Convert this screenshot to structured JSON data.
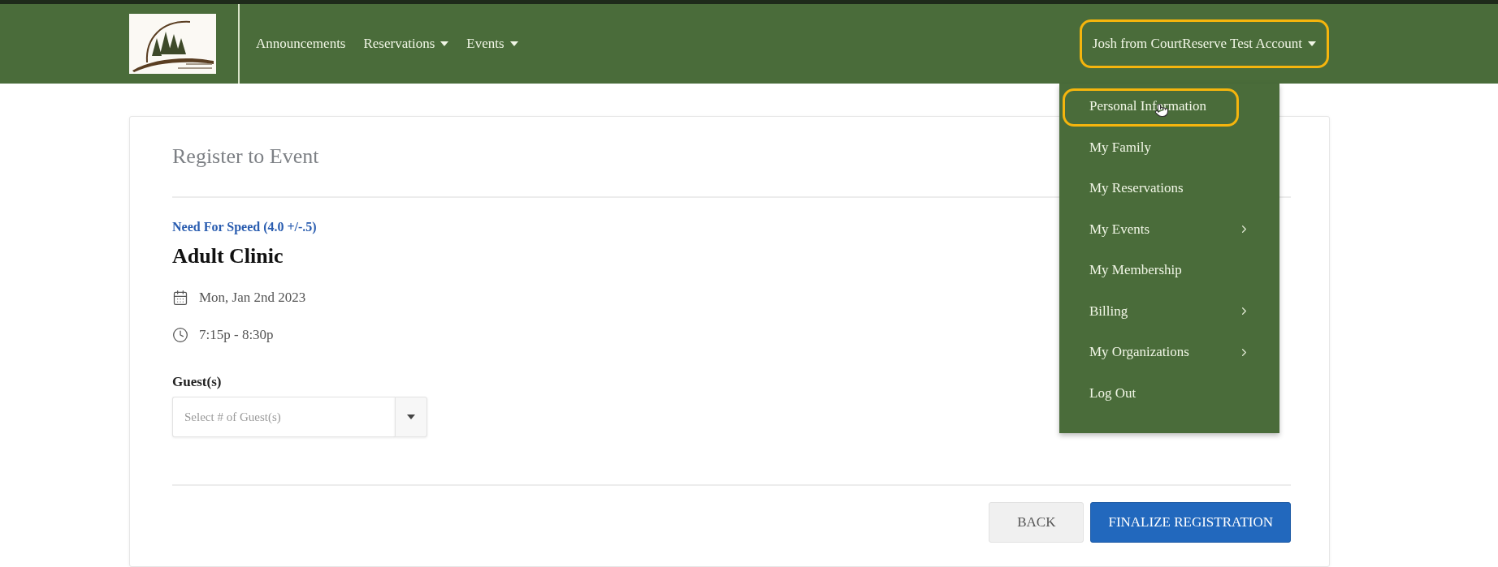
{
  "nav": [
    {
      "label": "Announcements",
      "has_menu": false
    },
    {
      "label": "Reservations",
      "has_menu": true
    },
    {
      "label": "Events",
      "has_menu": true
    }
  ],
  "account": {
    "label": "Josh from CourtReserve Test Account",
    "has_menu": true,
    "highlighted": true
  },
  "account_menu": {
    "open": true,
    "items": [
      {
        "label": "Personal Information",
        "has_submenu": false,
        "highlighted": true,
        "hovered": true
      },
      {
        "label": "My Family",
        "has_submenu": false,
        "highlighted": false,
        "hovered": false
      },
      {
        "label": "My Reservations",
        "has_submenu": false,
        "highlighted": false,
        "hovered": false
      },
      {
        "label": "My Events",
        "has_submenu": true,
        "highlighted": false,
        "hovered": false
      },
      {
        "label": "My Membership",
        "has_submenu": false,
        "highlighted": false,
        "hovered": false
      },
      {
        "label": "Billing",
        "has_submenu": true,
        "highlighted": false,
        "hovered": false
      },
      {
        "label": "My Organizations",
        "has_submenu": true,
        "highlighted": false,
        "hovered": false
      },
      {
        "label": "Log Out",
        "has_submenu": false,
        "highlighted": false,
        "hovered": false
      }
    ]
  },
  "event": {
    "page_title": "Register to Event",
    "program": "Need For Speed (4.0 +/-.5)",
    "title": "Adult Clinic",
    "date": "Mon, Jan 2nd 2023",
    "time": "7:15p - 8:30p",
    "guests": {
      "label": "Guest(s)",
      "placeholder": "Select # of Guest(s)"
    }
  },
  "buttons": [
    {
      "label": "BACK",
      "kind": "secondary"
    },
    {
      "label": "FINALIZE REGISTRATION",
      "kind": "primary"
    }
  ]
}
